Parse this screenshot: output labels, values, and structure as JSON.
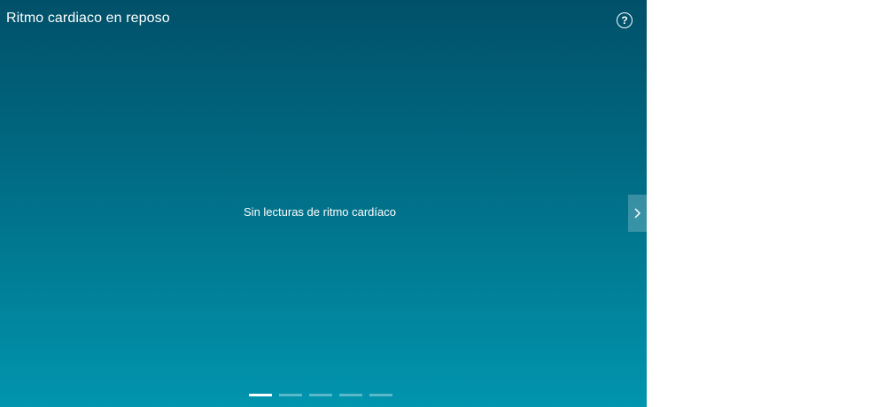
{
  "tile": {
    "title": "Ritmo cardiaco en reposo",
    "help_glyph": "?",
    "help_icon": "help-circle-icon",
    "empty_message": "Sin lecturas de ritmo cardíaco",
    "next_icon": "chevron-right-icon",
    "pager": {
      "count": 5,
      "active_index": 0
    },
    "colors": {
      "gradient_top": "#015069",
      "gradient_bottom": "#0195ae",
      "text": "#ffffff"
    }
  }
}
